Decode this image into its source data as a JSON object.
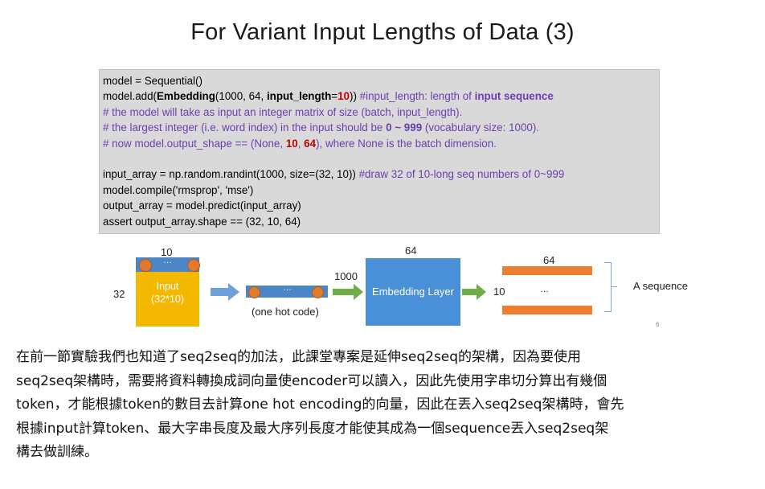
{
  "title": "For Variant Input Lengths of Data (3)",
  "code": {
    "l1": "model = Sequential()",
    "l2a": "model.add(",
    "l2b": "Embedding",
    "l2c": "(1000, 64, ",
    "l2d": "input_length",
    "l2e": "=",
    "l2f": "10",
    "l2g": ")) ",
    "l2h": "#input_length: length of ",
    "l2i": "input sequence",
    "l3": "# the model will take as input an integer matrix of size (batch, input_length).",
    "l4a": "# the largest integer (i.e. word index) in the input should be ",
    "l4b": "0 ~ 999",
    "l4c": " (vocabulary size: 1000).",
    "l5a": "# now model.output_shape == (None, ",
    "l5b": "10",
    "l5c": ", ",
    "l5d": "64",
    "l5e": "), where None is the batch dimension.",
    "l6a": "input_array = np.random.randint(1000, size=(32, 10)) ",
    "l6b": "#draw 32 of 10-long seq numbers of 0~999",
    "l7": "model.compile('rmsprop', 'mse')",
    "l8": "output_array = model.predict(input_array)",
    "l9": "assert output_array.shape == (32, 10, 64)"
  },
  "diagram": {
    "input_width_label": "10",
    "input_height_label": "32",
    "ellipsis": "…",
    "input_label_line1": "Input",
    "input_label_line2": "(32*10)",
    "onehot_label": "(one hot code)",
    "vocab_label": "1000",
    "embedding_dim_label": "64",
    "embedding_label": "Embedding Layer",
    "output_seq_label": "10",
    "output_dim_label": "64",
    "sequence_label": "A sequence",
    "page_number": "6",
    "colors": {
      "blue": "#4a86c8",
      "yellow": "#f5b800",
      "orange": "#ed7d31",
      "green": "#70ad47"
    }
  },
  "paragraph": {
    "line1": "在前一節實驗我們也知道了seq2seq的加法，此課堂專案是延伸seq2seq的架構，因為要使用",
    "line2": "seq2seq架構時，需要將資料轉換成詞向量使encoder可以讀入，因此先使用字串切分算出有幾個",
    "line3": "token，才能根據token的數目去計算one hot encoding的向量，因此在丟入seq2seq架構時，會先",
    "line4": "根據input計算token、最大字串長度及最大序列長度才能使其成為一個sequence丟入seq2seq架",
    "line5": "構去做訓練。"
  }
}
